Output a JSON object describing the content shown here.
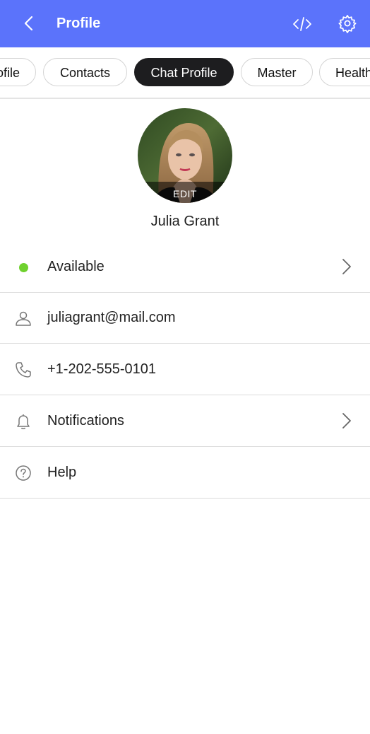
{
  "appbar": {
    "title": "Profile",
    "back_icon": "chevron-left-icon",
    "code_icon": "code-icon",
    "settings_icon": "gear-icon",
    "color": "#5b73fb"
  },
  "tabs": [
    {
      "label": "ofile",
      "active": false
    },
    {
      "label": "Contacts",
      "active": false
    },
    {
      "label": "Chat Profile",
      "active": true
    },
    {
      "label": "Master",
      "active": false
    },
    {
      "label": "Health",
      "active": false
    }
  ],
  "profile": {
    "avatar_edit_label": "EDIT",
    "name": "Julia Grant"
  },
  "rows": {
    "status": {
      "label": "Available",
      "icon": "status-dot",
      "color": "#6fd12e"
    },
    "email": {
      "label": "juliagrant@mail.com",
      "icon": "user-icon"
    },
    "phone": {
      "label": "+1-202-555-0101",
      "icon": "phone-icon"
    },
    "notifications": {
      "label": "Notifications",
      "icon": "bell-icon"
    },
    "help": {
      "label": "Help",
      "icon": "help-icon"
    }
  }
}
